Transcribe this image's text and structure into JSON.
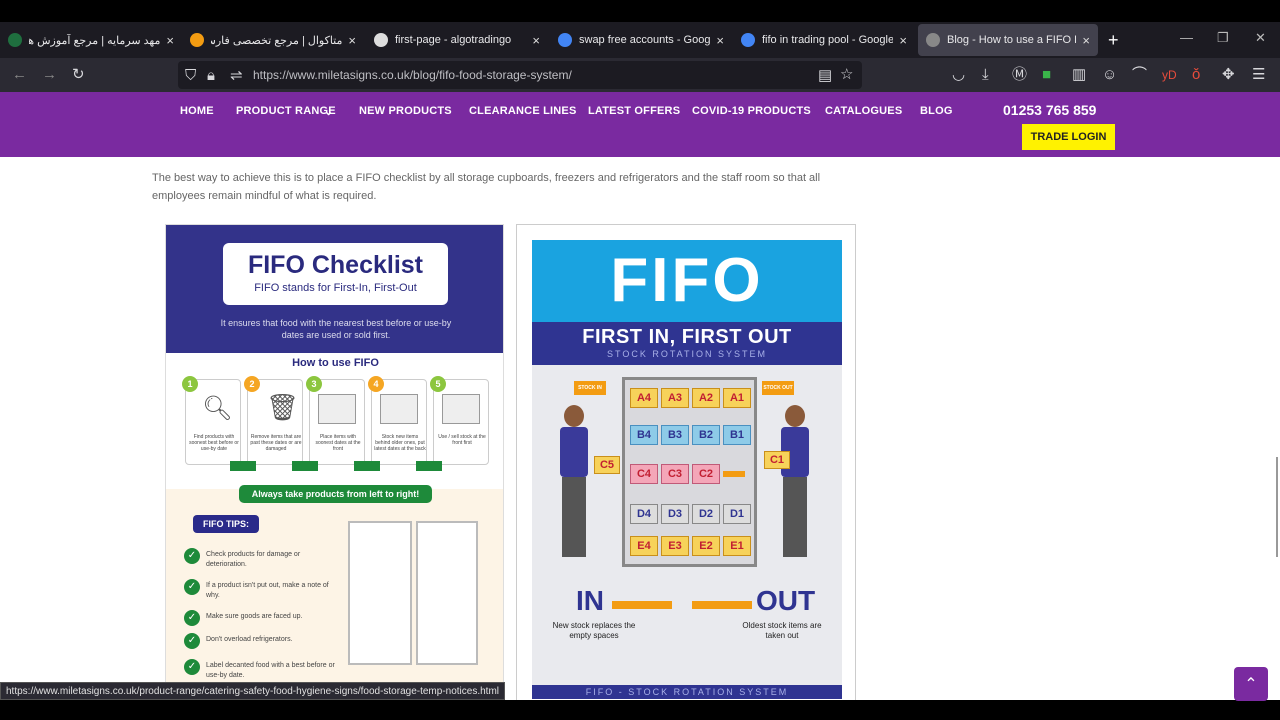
{
  "browser": {
    "tabs": [
      {
        "title": "مهد سرمایه | مرجع آموزش های",
        "favicon_color": "#1f6f3f"
      },
      {
        "title": "متاکوال | مرجع تخصصی فارسی",
        "favicon_color": "#f39c12"
      },
      {
        "title": "first-page - algotradingo",
        "favicon_color": "#dddddd"
      },
      {
        "title": "swap free accounts - Google S",
        "favicon_color": "#4285f4"
      },
      {
        "title": "fifo in trading pool - Google S",
        "favicon_color": "#4285f4"
      },
      {
        "title": "Blog - How to use a FIFO Food",
        "favicon_color": "#888888"
      }
    ],
    "new_tab_label": "+",
    "url": "https://www.miletasigns.co.uk/blog/fifo-food-storage-system/",
    "status_url": "https://www.miletasigns.co.uk/product-range/catering-safety-food-hygiene-signs/food-storage-temp-notices.html"
  },
  "site": {
    "nav": [
      "HOME",
      "PRODUCT RANGE",
      "NEW PRODUCTS",
      "CLEARANCE LINES",
      "LATEST OFFERS",
      "COVID-19 PRODUCTS",
      "CATALOGUES",
      "BLOG"
    ],
    "phone": "01253 765 859",
    "trade_login": "TRADE LOGIN",
    "brand_color": "#7a2aa0"
  },
  "article": {
    "paragraph": "The best way to achieve this is to place a FIFO checklist by all storage cupboards, freezers and refrigerators and the staff room so that all employees remain mindful of what is required."
  },
  "checklist": {
    "title": "FIFO Checklist",
    "subtitle": "FIFO stands for First-In, First-Out",
    "intro": "It ensures that food with the nearest best before or use-by dates are used or sold first.",
    "howto_title": "How to use FIFO",
    "steps": [
      {
        "n": "1",
        "text": "Find products with soonest best before or use-by date"
      },
      {
        "n": "2",
        "text": "Remove items that are past these dates or are damaged"
      },
      {
        "n": "3",
        "text": "Place items with soonest dates at the front"
      },
      {
        "n": "4",
        "text": "Stock new items behind older ones, put latest dates at the back"
      },
      {
        "n": "5",
        "text": "Use / sell stock at the front first"
      }
    ],
    "always": "Always take products from left to right!",
    "tips_title": "FIFO TIPS:",
    "tips": [
      "Check products for damage or deterioration.",
      "If a product isn't put out, make a note of why.",
      "Make sure goods are faced up.",
      "Don't overload refrigerators.",
      "Label decanted food with a best before or use-by date."
    ]
  },
  "poster": {
    "banner": "FIFO",
    "headline": "FIRST IN, FIRST OUT",
    "subhead": "STOCK ROTATION SYSTEM",
    "stock_in": "STOCK IN",
    "stock_out": "STOCK OUT",
    "rows": [
      [
        "A4",
        "A3",
        "A2",
        "A1"
      ],
      [
        "B4",
        "B3",
        "B2",
        "B1"
      ],
      [
        "C4",
        "C3",
        "C2",
        ""
      ],
      [
        "D4",
        "D3",
        "D2",
        "D1"
      ],
      [
        "E4",
        "E3",
        "E2",
        "E1"
      ]
    ],
    "carry_in": "C5",
    "carry_out": "C1",
    "in_label": "IN",
    "out_label": "OUT",
    "new_text": "New stock replaces the empty spaces",
    "old_text": "Oldest stock items are taken out",
    "footer": "FIFO - STOCK ROTATION SYSTEM"
  }
}
